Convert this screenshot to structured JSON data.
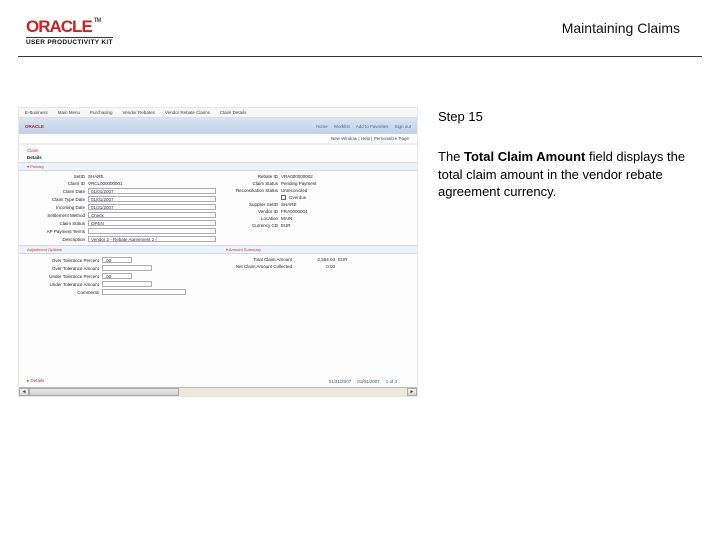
{
  "header": {
    "logo_text": "ORACLE",
    "logo_tm": "TM",
    "logo_subtitle": "USER PRODUCTIVITY KIT",
    "topic_title": "Maintaining Claims"
  },
  "step": {
    "label": "Step 15",
    "description_prefix": "The ",
    "description_bold": "Total Claim Amount",
    "description_suffix": " field displays the total claim amount in the vendor rebate agreement currency."
  },
  "thumb": {
    "tabs": [
      "E-Business",
      "Main Menu",
      "Purchasing",
      "Vendor Rebates",
      "Vendor Rebate Claims",
      "Claim Details"
    ],
    "brand": "ORACLE",
    "nav_links": [
      "Home",
      "Worklist",
      "Add to Favorites",
      "Sign out"
    ],
    "userline": "New Window | Help | Personalize Page",
    "title_line": "Claim",
    "details_label": "Details",
    "section_primary": "▾ Primary",
    "left_fields": [
      {
        "label": "SetID",
        "value": "SHARE"
      },
      {
        "label": "Claim ID",
        "value": "VRCL000000001"
      },
      {
        "label": "Claim Date",
        "value": "01/01/2007"
      },
      {
        "label": "Claim Type Date",
        "value": "01/01/2007"
      },
      {
        "label": "Incoming Date",
        "value": "01/31/2007",
        "boxed": true
      },
      {
        "label": "Settlement Method",
        "value": "Check"
      },
      {
        "label": "Claim Status",
        "value": "OPEN"
      },
      {
        "label": "AP Payment Terms",
        "value": ""
      },
      {
        "label": "Description",
        "value": "Vendor 2 - Rebate Agreement 2 ("
      }
    ],
    "right_fields": [
      {
        "label": "Rebate ID",
        "value": "VRA000000002"
      },
      {
        "label": "Claim Status",
        "value": "Pending Payment"
      },
      {
        "label": "Reconciliation Status",
        "value": "Unreconciled"
      },
      {
        "label": "Overdue",
        "checkbox": true
      },
      {
        "label": "Supplier SetID",
        "value": "SHARE"
      },
      {
        "label": "Vendor ID",
        "value": "FRA0000004"
      },
      {
        "label": "Location",
        "value": "MAIN"
      },
      {
        "label": "Currency CD",
        "value": "EUR"
      }
    ],
    "section_adj": "Adjustment Options",
    "section_amt": "▾ Amount Summary",
    "adj_fields": [
      {
        "label": "Over Tolerance Percent",
        "value": ".00"
      },
      {
        "label": "Over Tolerance Amount",
        "value": ""
      },
      {
        "label": "Under Tolerance Percent",
        "value": ".00"
      },
      {
        "label": "Under Tolerance Amount",
        "value": ""
      },
      {
        "label": "Comments",
        "value": ""
      }
    ],
    "amt_fields": [
      {
        "label": "Total Claim Amount",
        "value": "2,554.04",
        "cur": "EUR"
      },
      {
        "label": "Net Claim Amount Collected",
        "value": "0.00"
      }
    ],
    "footer_section": "▸ Details",
    "pager": [
      "01/31/2007",
      "01/01/2007",
      "1  of  3"
    ]
  }
}
